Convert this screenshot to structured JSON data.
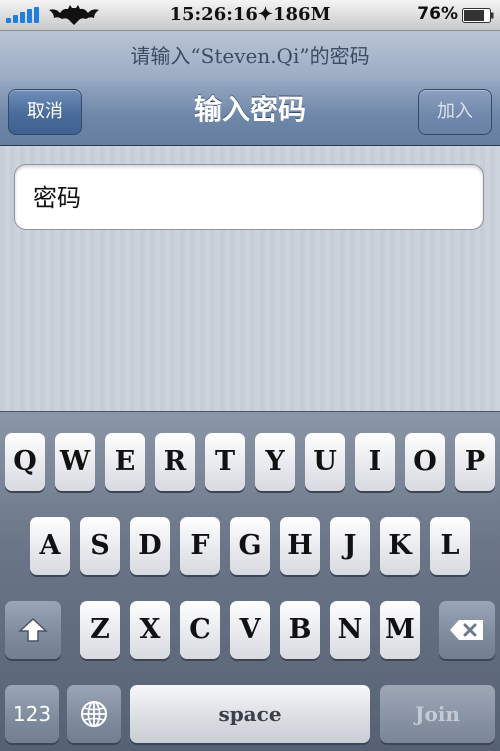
{
  "status_bar": {
    "time": "15:26:16✦186M",
    "battery": "76%",
    "signal_color": "#1f7fe0"
  },
  "prompt": "请输入“Steven.Qi”的密码",
  "nav": {
    "cancel_label": "取消",
    "title": "输入密码",
    "join_label": "加入"
  },
  "password_field": {
    "placeholder": "密码",
    "value": ""
  },
  "keyboard": {
    "row1": [
      "Q",
      "W",
      "E",
      "R",
      "T",
      "Y",
      "U",
      "I",
      "O",
      "P"
    ],
    "row2": [
      "A",
      "S",
      "D",
      "F",
      "G",
      "H",
      "J",
      "K",
      "L"
    ],
    "row3": [
      "Z",
      "X",
      "C",
      "V",
      "B",
      "N",
      "M"
    ],
    "numbers_label": "123",
    "space_label": "space",
    "join_label": "Join",
    "icons": {
      "shift": "shift-arrow-icon",
      "delete": "backspace-icon",
      "globe": "globe-icon"
    }
  }
}
